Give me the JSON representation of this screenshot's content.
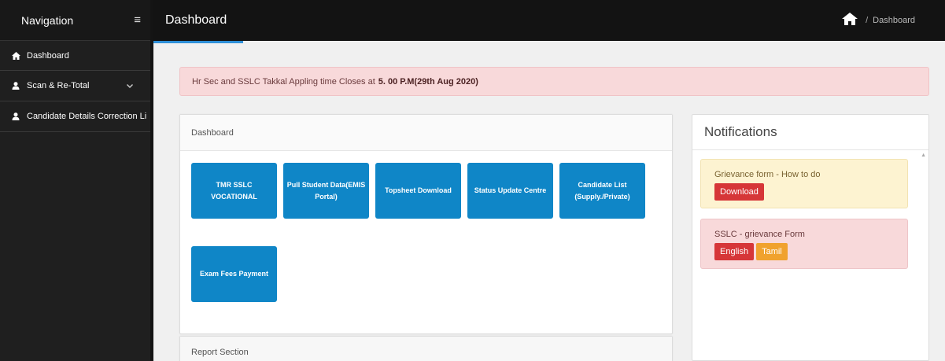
{
  "sidebar": {
    "title": "Navigation",
    "menu_icon": "hamburger-icon",
    "items": [
      {
        "label": "Dashboard",
        "icon": "home-icon"
      },
      {
        "label": "Scan & Re-Total",
        "icon": "user-icon",
        "chevron": "chevron-down-icon"
      },
      {
        "label": "Candidate Details Correction Li",
        "icon": "user-icon"
      }
    ]
  },
  "header": {
    "title": "Dashboard",
    "breadcrumb": {
      "home_icon": "home-icon",
      "separator": "/",
      "current": "Dashboard"
    }
  },
  "alert": {
    "text": "Hr Sec and SSLC Takkal Appling time Closes at",
    "highlight": "5. 00 P.M(29th Aug 2020)"
  },
  "dashboard_panel": {
    "title": "Dashboard",
    "tiles": [
      "TMR SSLC VOCATIONAL",
      "Pull Student Data(EMIS Portal)",
      "Topsheet Download",
      "Status Update Centre",
      "Candidate List (Supply./Private)",
      "Exam Fees Payment"
    ]
  },
  "report_panel": {
    "title": "Report Section"
  },
  "notifications": {
    "title": "Notifications",
    "cards": [
      {
        "text": "Grievance form - How to do",
        "buttons": [
          "Download"
        ]
      },
      {
        "text": "SSLC - grievance Form",
        "buttons": [
          "English",
          "Tamil"
        ]
      }
    ]
  },
  "colors": {
    "tile": "#0f86c7",
    "sidebar": "#1f1f1f",
    "topbar": "#131313",
    "accent": "#2f8fd8",
    "alert_bg": "#f8d9da",
    "warn_bg": "#fdf3d1",
    "btn_red": "#d63638",
    "btn_orange": "#f0a22e"
  }
}
